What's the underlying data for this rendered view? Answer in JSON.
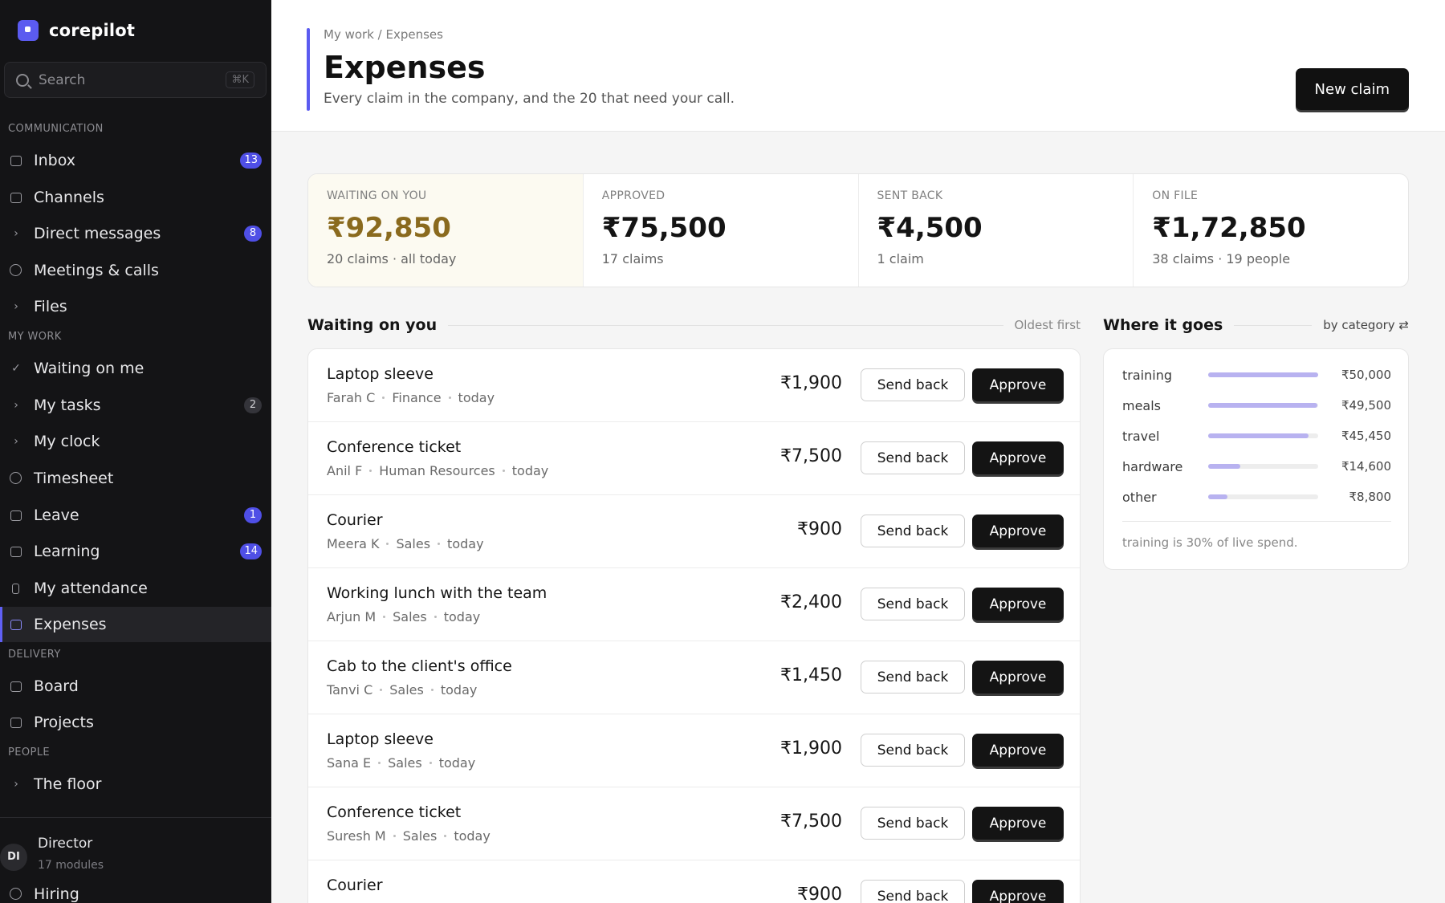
{
  "app": {
    "name": "corepilot"
  },
  "search": {
    "placeholder": "Search",
    "shortcut": "⌘K"
  },
  "sidebar": {
    "sections": {
      "communication": "COMMUNICATION",
      "my_work": "MY WORK",
      "delivery": "DELIVERY",
      "people": "PEOPLE"
    },
    "items": [
      {
        "label": "Inbox",
        "icon": "inbox-icon",
        "badge": "13"
      },
      {
        "label": "Channels",
        "icon": "chat-icon"
      },
      {
        "label": "Direct messages",
        "icon": "chevron-right-icon",
        "badge": "8"
      },
      {
        "label": "Meetings & calls",
        "icon": "headset-icon"
      },
      {
        "label": "Files",
        "icon": "chevron-right-icon"
      },
      {
        "label": "Waiting on me",
        "icon": "check-icon"
      },
      {
        "label": "My tasks",
        "icon": "chevron-right-icon",
        "badge": "2"
      },
      {
        "label": "My clock",
        "icon": "chevron-right-icon"
      },
      {
        "label": "Timesheet",
        "icon": "clock-icon"
      },
      {
        "label": "Leave",
        "icon": "calendar-icon",
        "badge": "1"
      },
      {
        "label": "Learning",
        "icon": "easel-icon",
        "badge": "14"
      },
      {
        "label": "My attendance",
        "icon": "phone-icon"
      },
      {
        "label": "Expenses",
        "icon": "card-icon",
        "active": true
      },
      {
        "label": "Board",
        "icon": "board-icon"
      },
      {
        "label": "Projects",
        "icon": "briefcase-icon"
      },
      {
        "label": "The floor",
        "icon": "chevron-right-icon"
      },
      {
        "label": "Hiring",
        "icon": "user-plus-icon"
      }
    ],
    "user": {
      "initials": "DI",
      "name": "Director",
      "meta": "17 modules"
    }
  },
  "header": {
    "breadcrumb": "My work / Expenses",
    "title": "Expenses",
    "subtitle": "Every claim in the company, and the 20 that need your call.",
    "new_claim": "New claim"
  },
  "stats": [
    {
      "label": "WAITING ON YOU",
      "value": "₹92,850",
      "sub": "20 claims · all today"
    },
    {
      "label": "APPROVED",
      "value": "₹75,500",
      "sub": "17 claims"
    },
    {
      "label": "SENT BACK",
      "value": "₹4,500",
      "sub": "1 claim"
    },
    {
      "label": "ON FILE",
      "value": "₹1,72,850",
      "sub": "38 claims · 19 people"
    }
  ],
  "waiting": {
    "title": "Waiting on you",
    "sort": "Oldest first",
    "send_back": "Send back",
    "approve": "Approve",
    "rows": [
      {
        "title": "Laptop sleeve",
        "person": "Farah C",
        "dept": "Finance",
        "when": "today",
        "amount": "₹1,900"
      },
      {
        "title": "Conference ticket",
        "person": "Anil F",
        "dept": "Human Resources",
        "when": "today",
        "amount": "₹7,500"
      },
      {
        "title": "Courier",
        "person": "Meera K",
        "dept": "Sales",
        "when": "today",
        "amount": "₹900"
      },
      {
        "title": "Working lunch with the team",
        "person": "Arjun M",
        "dept": "Sales",
        "when": "today",
        "amount": "₹2,400"
      },
      {
        "title": "Cab to the client's office",
        "person": "Tanvi C",
        "dept": "Sales",
        "when": "today",
        "amount": "₹1,450"
      },
      {
        "title": "Laptop sleeve",
        "person": "Sana E",
        "dept": "Sales",
        "when": "today",
        "amount": "₹1,900"
      },
      {
        "title": "Conference ticket",
        "person": "Suresh M",
        "dept": "Sales",
        "when": "today",
        "amount": "₹7,500"
      },
      {
        "title": "Courier",
        "person": "",
        "dept": "",
        "when": "",
        "amount": "₹900"
      }
    ]
  },
  "where": {
    "title": "Where it goes",
    "toggle": "by category ⇄",
    "categories": [
      {
        "name": "training",
        "amount": "₹50,000",
        "share": 1.0
      },
      {
        "name": "meals",
        "amount": "₹49,500",
        "share": 0.99
      },
      {
        "name": "travel",
        "amount": "₹45,450",
        "share": 0.909
      },
      {
        "name": "hardware",
        "amount": "₹14,600",
        "share": 0.292
      },
      {
        "name": "other",
        "amount": "₹8,800",
        "share": 0.176
      }
    ],
    "note": "training is 30% of live spend."
  },
  "colors": {
    "accent": "#5b5bf0",
    "warm": "#8a6a1e",
    "bar": "#b8b2f0"
  }
}
